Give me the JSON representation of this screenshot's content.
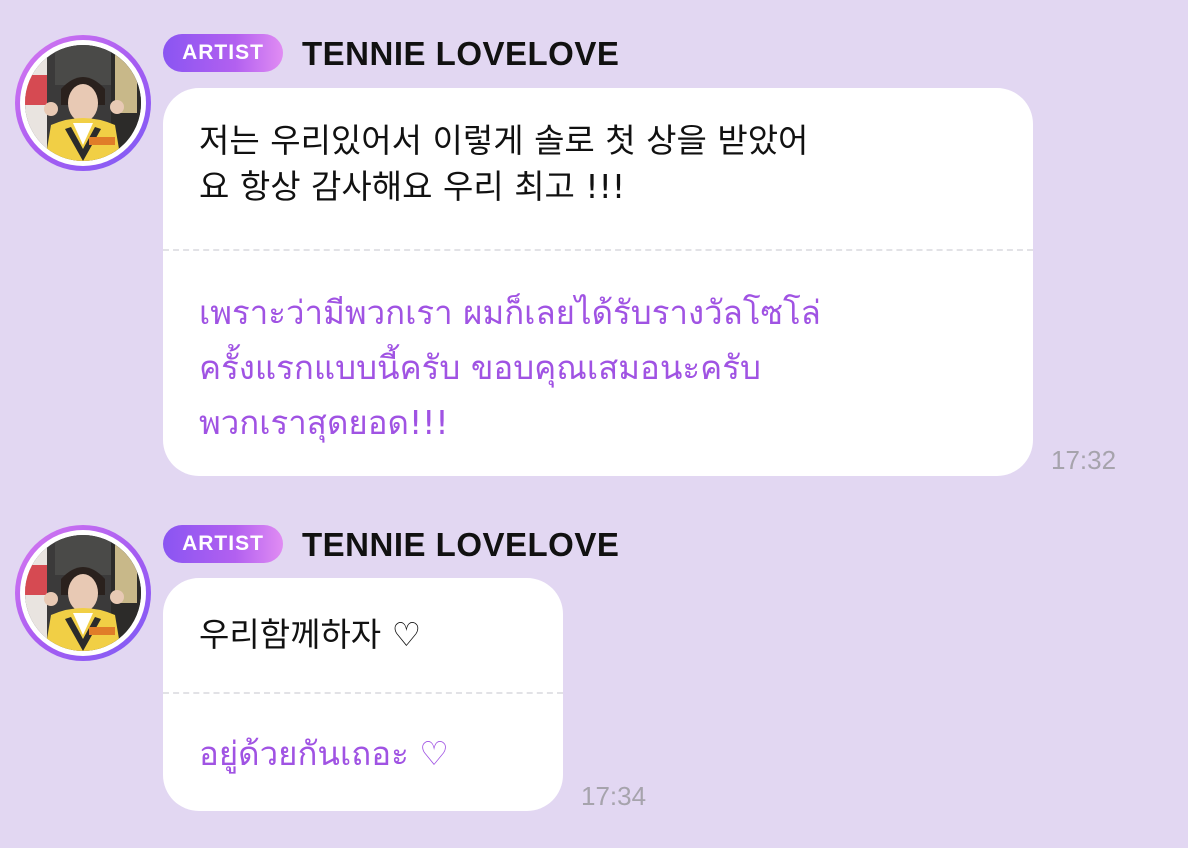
{
  "messages": [
    {
      "badge": "ARTIST",
      "sender": "TENNIE LOVELOVE",
      "korean_lines": [
        "저는 우리있어서 이렇게 솔로 첫 상을 받았어",
        "요 항상 감사해요 우리 최고 !!!"
      ],
      "thai_lines": [
        "เพราะว่ามีพวกเรา ผมก็เลยได้รับรางวัลโซโล่",
        "ครั้งแรกแบบนี้ครับ ขอบคุณเสมอนะครับ",
        "พวกเราสุดยอด!!!"
      ],
      "time": "17:32"
    },
    {
      "badge": "ARTIST",
      "sender": "TENNIE LOVELOVE",
      "korean_lines": [
        "우리함께하자 ♡"
      ],
      "thai_lines": [
        "อยู่ด้วยกันเถอะ ♡"
      ],
      "time": "17:34"
    }
  ],
  "colors": {
    "background": "#e2d7f2",
    "bubble": "#ffffff",
    "translation_text": "#a053e3",
    "badge_start": "#8a55f2",
    "badge_end": "#e08cf3",
    "timestamp": "#a6a3ac"
  },
  "icons": {
    "avatar": "profile-photo"
  }
}
